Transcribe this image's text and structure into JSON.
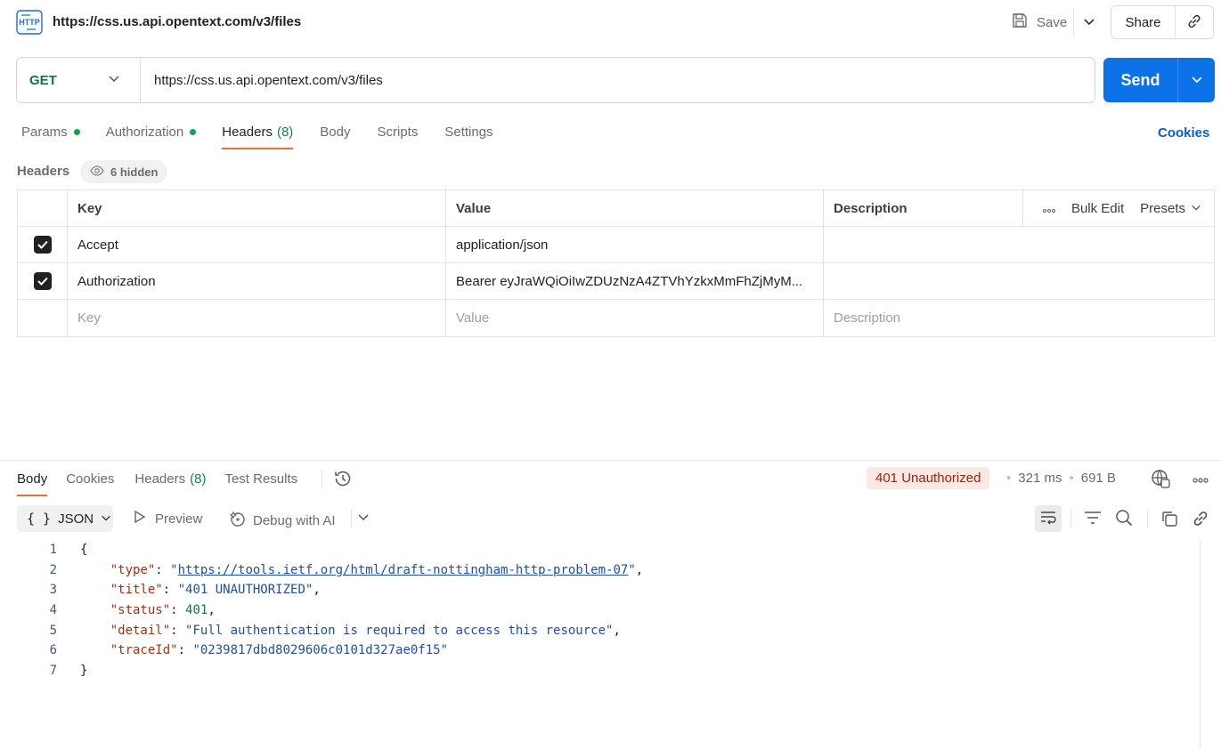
{
  "topbar": {
    "request_title": "https://css.us.api.opentext.com/v3/files",
    "save_label": "Save",
    "share_label": "Share"
  },
  "request": {
    "method": "GET",
    "url": "https://css.us.api.opentext.com/v3/files",
    "send_label": "Send"
  },
  "request_tabs": [
    {
      "label": "Params",
      "dot": true
    },
    {
      "label": "Authorization",
      "dot": true
    },
    {
      "label": "Headers",
      "count": "(8)",
      "active": true
    },
    {
      "label": "Body"
    },
    {
      "label": "Scripts"
    },
    {
      "label": "Settings"
    }
  ],
  "cookies_link": "Cookies",
  "headers_section": {
    "label": "Headers",
    "hidden_label": "6 hidden",
    "columns": {
      "key": "Key",
      "value": "Value",
      "description": "Description"
    },
    "tools": {
      "bulk_edit": "Bulk Edit",
      "presets": "Presets"
    },
    "rows": [
      {
        "checked": true,
        "key": "Accept",
        "value": "application/json",
        "description": ""
      },
      {
        "checked": true,
        "key": "Authorization",
        "value": "Bearer eyJraWQiOiIwZDUzNzA4ZTVhYzkxMmFhZjMyM...",
        "description": ""
      }
    ],
    "placeholders": {
      "key": "Key",
      "value": "Value",
      "description": "Description"
    }
  },
  "response_tabs": [
    {
      "label": "Body",
      "active": true
    },
    {
      "label": "Cookies"
    },
    {
      "label": "Headers",
      "count": "(8)"
    },
    {
      "label": "Test Results"
    }
  ],
  "response_meta": {
    "status": "401 Unauthorized",
    "time": "321 ms",
    "size": "691 B"
  },
  "response_toolbar": {
    "format": "JSON",
    "preview_label": "Preview",
    "debug_label": "Debug with AI"
  },
  "code_lines": [
    {
      "n": "1",
      "parts": [
        {
          "t": "{",
          "c": ""
        }
      ]
    },
    {
      "n": "2",
      "parts": [
        {
          "t": "    ",
          "c": ""
        },
        {
          "t": "\"type\"",
          "c": "k"
        },
        {
          "t": ": ",
          "c": ""
        },
        {
          "t": "\"",
          "c": "s"
        },
        {
          "t": "https://tools.ietf.org/html/draft-nottingham-http-problem-07",
          "c": "u"
        },
        {
          "t": "\"",
          "c": "s"
        },
        {
          "t": ",",
          "c": ""
        }
      ]
    },
    {
      "n": "3",
      "parts": [
        {
          "t": "    ",
          "c": ""
        },
        {
          "t": "\"title\"",
          "c": "k"
        },
        {
          "t": ": ",
          "c": ""
        },
        {
          "t": "\"401 UNAUTHORIZED\"",
          "c": "s"
        },
        {
          "t": ",",
          "c": ""
        }
      ]
    },
    {
      "n": "4",
      "parts": [
        {
          "t": "    ",
          "c": ""
        },
        {
          "t": "\"status\"",
          "c": "k"
        },
        {
          "t": ": ",
          "c": ""
        },
        {
          "t": "401",
          "c": "n"
        },
        {
          "t": ",",
          "c": ""
        }
      ]
    },
    {
      "n": "5",
      "parts": [
        {
          "t": "    ",
          "c": ""
        },
        {
          "t": "\"detail\"",
          "c": "k"
        },
        {
          "t": ": ",
          "c": ""
        },
        {
          "t": "\"Full authentication is required to access this resource\"",
          "c": "s"
        },
        {
          "t": ",",
          "c": ""
        }
      ]
    },
    {
      "n": "6",
      "parts": [
        {
          "t": "    ",
          "c": ""
        },
        {
          "t": "\"traceId\"",
          "c": "k"
        },
        {
          "t": ": ",
          "c": ""
        },
        {
          "t": "\"0239817dbd8029606c0101d327ae0f15\"",
          "c": "s"
        }
      ]
    },
    {
      "n": "7",
      "parts": [
        {
          "t": "}",
          "c": ""
        }
      ]
    }
  ],
  "colors": {
    "send": "#0d72e8",
    "method_get": "#0b7a3b",
    "active_tab_underline": "#f26b3a",
    "status_bg": "#fde9e4",
    "status_text": "#a3200e",
    "json_key": "#a0330f",
    "json_string": "#1f4fa3",
    "json_number": "#0a7a3a"
  },
  "icons": [
    "http-icon",
    "save-icon",
    "chevron-down-icon",
    "link-icon",
    "eye-icon",
    "check-icon",
    "more-icon",
    "history-icon",
    "globe-icon",
    "braces-icon",
    "play-icon",
    "sparkle-icon",
    "wrap-icon",
    "filter-icon",
    "search-icon",
    "copy-icon"
  ]
}
